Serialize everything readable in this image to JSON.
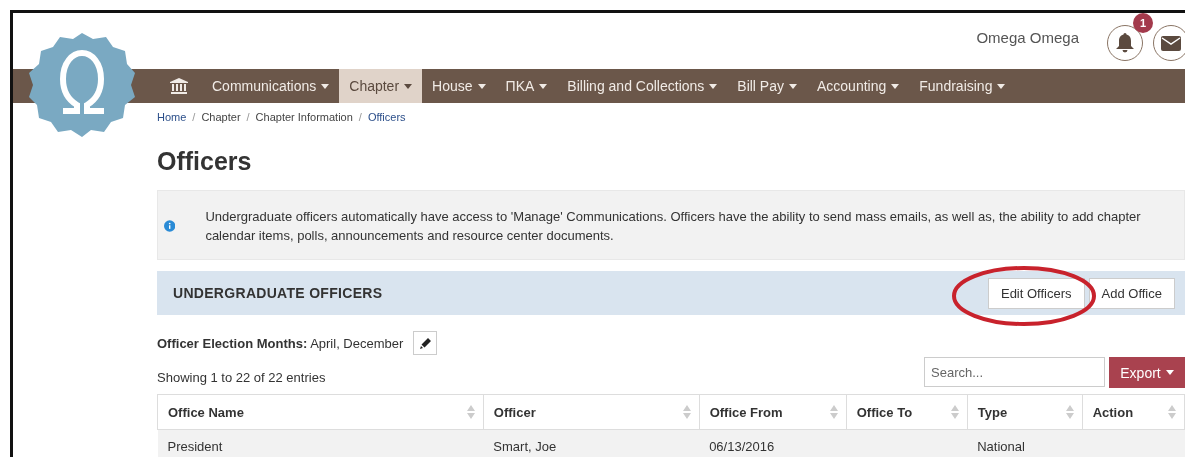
{
  "header": {
    "user_name": "Omega Omega",
    "notifications": {
      "count": "1"
    }
  },
  "nav": [
    {
      "label": "Communications",
      "selected": false
    },
    {
      "label": "Chapter",
      "selected": true
    },
    {
      "label": "House",
      "selected": false
    },
    {
      "label": "ΠΚΑ",
      "selected": false
    },
    {
      "label": "Billing and Collections",
      "selected": false
    },
    {
      "label": "Bill Pay",
      "selected": false
    },
    {
      "label": "Accounting",
      "selected": false
    },
    {
      "label": "Fundraising",
      "selected": false
    }
  ],
  "breadcrumb": [
    {
      "label": "Home",
      "kind": "link"
    },
    {
      "separator": "/",
      "label": "Chapter",
      "kind": "text"
    },
    {
      "separator": "/",
      "label": "Chapter Information",
      "kind": "text"
    },
    {
      "separator": "/",
      "label": "Officers",
      "kind": "link"
    }
  ],
  "title": "Officers",
  "info": "Undergraduate officers automatically have access to 'Manage' Communications. Officers have the ability to send mass emails, as well as, the ability to add chapter calendar items, polls, announcements and resource center documents.",
  "panel": {
    "title": "UNDERGRADUATE OFFICERS",
    "buttons": [
      "Edit Officers",
      "Add Office"
    ]
  },
  "election_months": "**Officer Election Months:** April, December",
  "entries_info": "Showing 1 to 22 of 22 entries",
  "search": {
    "placeholder": "Search..."
  },
  "export_button": "Export",
  "table": {
    "columns": [
      "Office Name",
      "Officer",
      "Office From",
      "Office To",
      "Type",
      "Action"
    ],
    "rows": [
      [
        "President",
        "Smart, Joe",
        "06/13/2016",
        "",
        "National",
        ""
      ]
    ]
  }
}
